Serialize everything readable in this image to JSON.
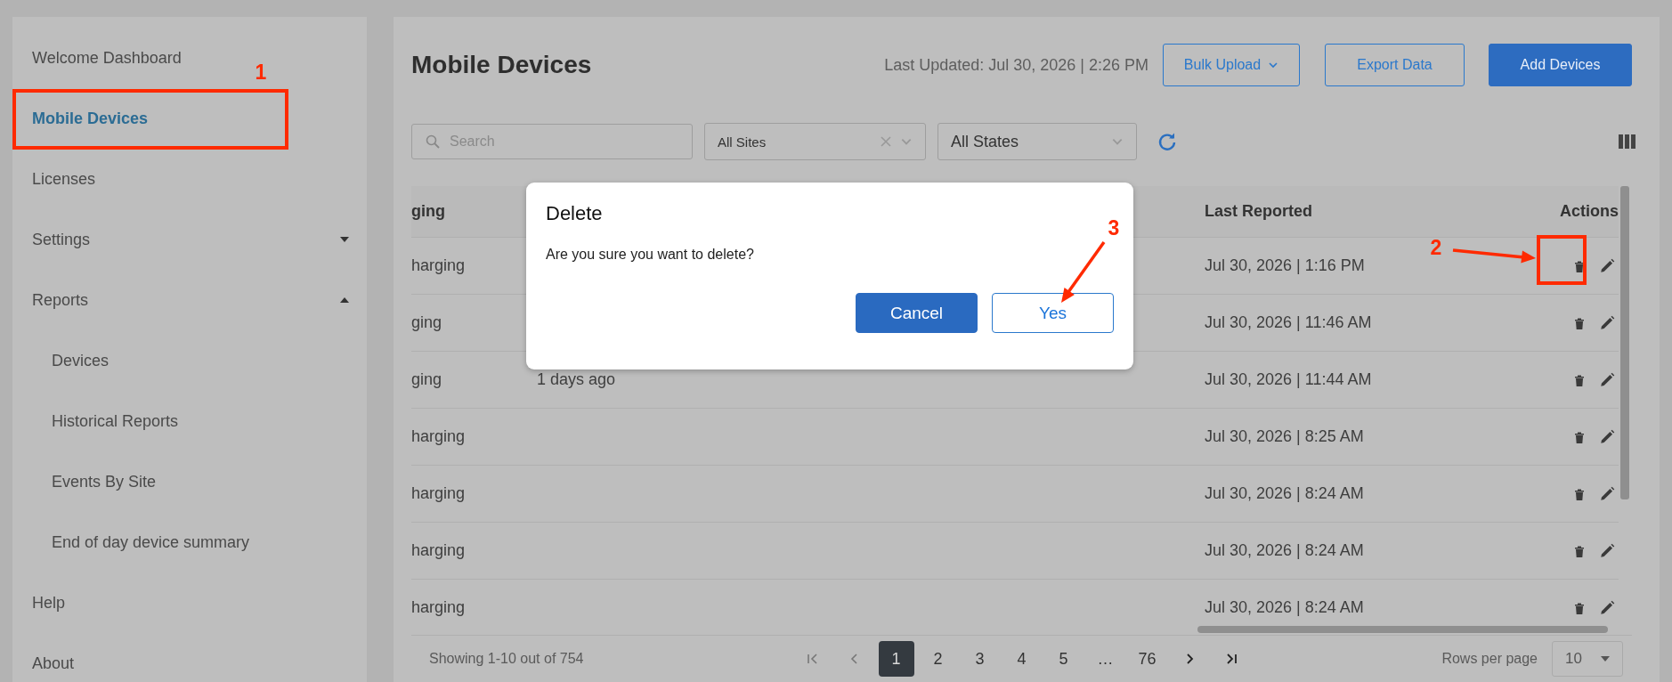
{
  "sidebar": {
    "items": [
      {
        "label": "Welcome Dashboard",
        "selected": false
      },
      {
        "label": "Mobile Devices",
        "selected": true
      },
      {
        "label": "Licenses",
        "selected": false
      },
      {
        "label": "Settings",
        "selected": false,
        "expanded": false
      },
      {
        "label": "Reports",
        "selected": false,
        "expanded": true,
        "children": [
          {
            "label": "Devices",
            "selected": false
          },
          {
            "label": "Historical Reports",
            "selected": false
          },
          {
            "label": "Events By Site",
            "selected": false
          },
          {
            "label": "End of day device summary",
            "selected": false
          }
        ]
      },
      {
        "label": "Help",
        "selected": false
      },
      {
        "label": "About",
        "selected": false
      }
    ]
  },
  "header": {
    "title": "Mobile Devices",
    "last_updated": "Last Updated: Jul 30, 2026 | 2:26 PM",
    "buttons": [
      {
        "label": "Bulk Upload",
        "kind": "dropdown"
      },
      {
        "label": "Export Data",
        "kind": "outline"
      },
      {
        "label": "Add Devices",
        "kind": "primary"
      }
    ]
  },
  "filters": {
    "search": {
      "placeholder": "Search"
    },
    "site_select": {
      "value": "All Sites"
    },
    "state_select": {
      "value": "All States"
    }
  },
  "table": {
    "columns": [
      {
        "label": "ging"
      },
      {
        "label": "Last Reported"
      },
      {
        "label": "Actions"
      }
    ],
    "rows": [
      {
        "column_1": "harging",
        "last_reported": "Jul 30, 2026 | 1:16 PM"
      },
      {
        "column_1": "ging",
        "last_reported": "Jul 30, 2026 | 11:46 AM"
      },
      {
        "column_1": "ging",
        "column_2": "1 days ago",
        "last_reported": "Jul 30, 2026 | 11:44 AM"
      },
      {
        "column_1": "harging",
        "last_reported": "Jul 30, 2026 | 8:25 AM"
      },
      {
        "column_1": "harging",
        "last_reported": "Jul 30, 2026 | 8:24 AM"
      },
      {
        "column_1": "harging",
        "last_reported": "Jul 30, 2026 | 8:24 AM"
      },
      {
        "column_1": "harging",
        "last_reported": "Jul 30, 2026 | 8:24 AM"
      }
    ]
  },
  "footer": {
    "showing": "Showing 1-10 out of 754",
    "pages": [
      {
        "label": "1",
        "selected": true
      },
      {
        "label": "2",
        "selected": false
      },
      {
        "label": "3",
        "selected": false
      },
      {
        "label": "4",
        "selected": false
      },
      {
        "label": "5",
        "selected": false
      },
      {
        "label": "…",
        "selected": false
      },
      {
        "label": "76",
        "selected": false
      }
    ],
    "rows_per_page_label": "Rows per page",
    "rows_per_page": "10"
  },
  "dialog": {
    "title": "Delete",
    "message": "Are you sure you want to delete?",
    "buttons": [
      {
        "label": "Cancel",
        "kind": "primary"
      },
      {
        "label": "Yes",
        "kind": "outline"
      }
    ]
  },
  "annotations": [
    {
      "label": "1",
      "kind": "box"
    },
    {
      "label": "2",
      "kind": "arrow_box"
    },
    {
      "label": "3",
      "kind": "arrow"
    }
  ]
}
